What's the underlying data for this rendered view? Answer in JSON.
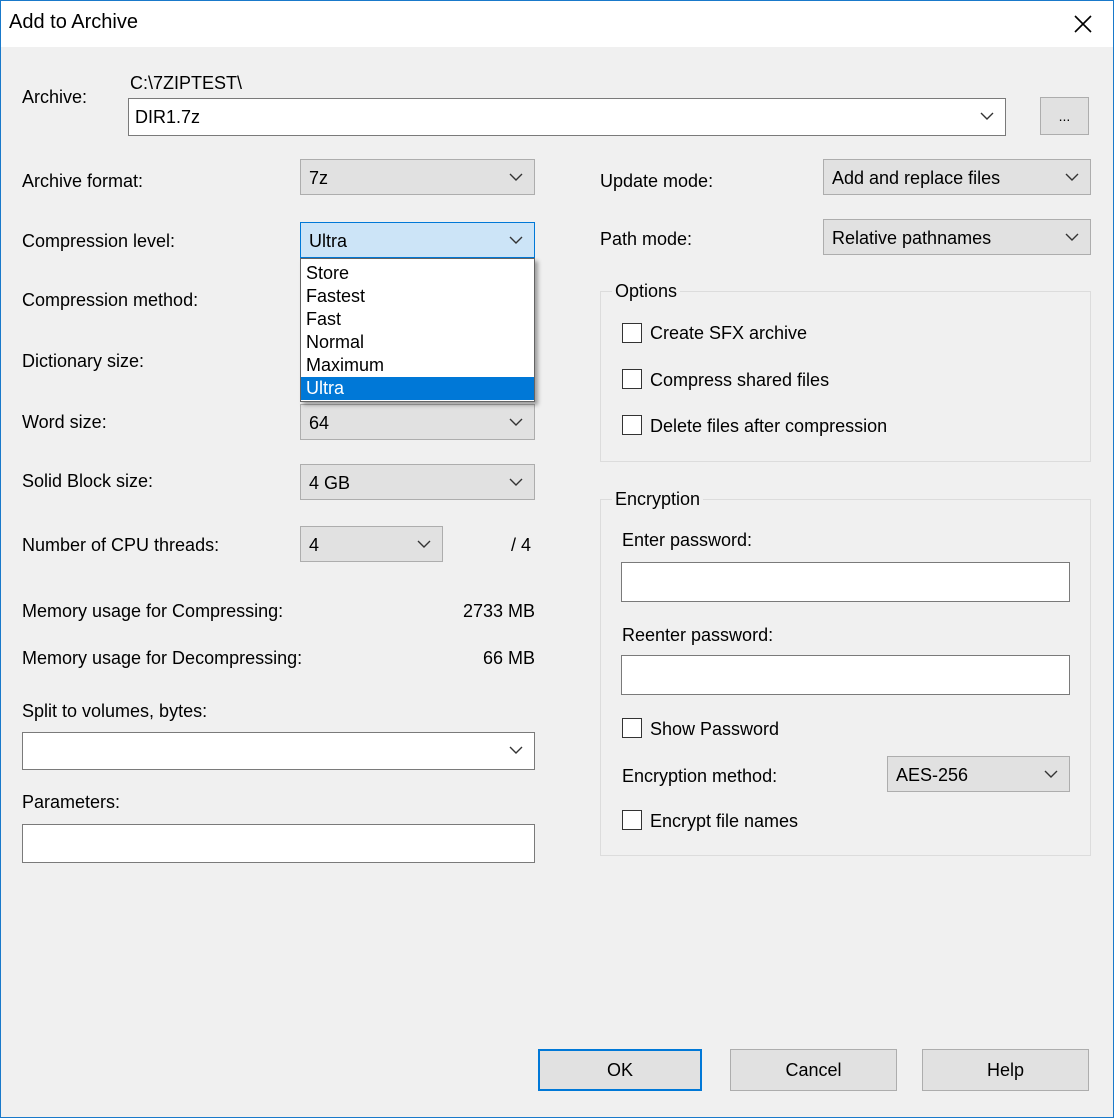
{
  "window": {
    "title": "Add to Archive"
  },
  "archive": {
    "label": "Archive:",
    "path": "C:\\7ZIPTEST\\",
    "filename": "DIR1.7z",
    "browse_label": "..."
  },
  "left": {
    "archive_format": {
      "label": "Archive format:",
      "value": "7z"
    },
    "compression_level": {
      "label": "Compression level:",
      "value": "Ultra"
    },
    "compression_method": {
      "label": "Compression method:"
    },
    "dictionary_size": {
      "label": "Dictionary size:"
    },
    "word_size": {
      "label": "Word size:",
      "value": "64"
    },
    "solid_block": {
      "label": "Solid Block size:",
      "value": "4 GB"
    },
    "cpu_threads": {
      "label": "Number of CPU threads:",
      "value": "4",
      "max": "/ 4"
    },
    "mem_compress": {
      "label": "Memory usage for Compressing:",
      "value": "2733 MB"
    },
    "mem_decompress": {
      "label": "Memory usage for Decompressing:",
      "value": "66 MB"
    },
    "split": {
      "label": "Split to volumes, bytes:",
      "value": ""
    },
    "parameters": {
      "label": "Parameters:",
      "value": ""
    }
  },
  "dropdown": {
    "options": [
      "Store",
      "Fastest",
      "Fast",
      "Normal",
      "Maximum",
      "Ultra"
    ],
    "selected": "Ultra"
  },
  "right": {
    "update_mode": {
      "label": "Update mode:",
      "value": "Add and replace files"
    },
    "path_mode": {
      "label": "Path mode:",
      "value": "Relative pathnames"
    },
    "options": {
      "title": "Options",
      "sfx": "Create SFX archive",
      "shared": "Compress shared files",
      "delete": "Delete files after compression"
    },
    "encryption": {
      "title": "Encryption",
      "enter_password": "Enter password:",
      "reenter_password": "Reenter password:",
      "show_password": "Show Password",
      "method_label": "Encryption method:",
      "method_value": "AES-256",
      "encrypt_names": "Encrypt file names"
    }
  },
  "buttons": {
    "ok": "OK",
    "cancel": "Cancel",
    "help": "Help"
  },
  "icons": {
    "close": "close-icon",
    "chevron": "chevron-down-icon"
  },
  "colors": {
    "accent": "#0078d7",
    "focus_fill": "#cce4f7",
    "dialog_bg": "#f0f0f0"
  }
}
